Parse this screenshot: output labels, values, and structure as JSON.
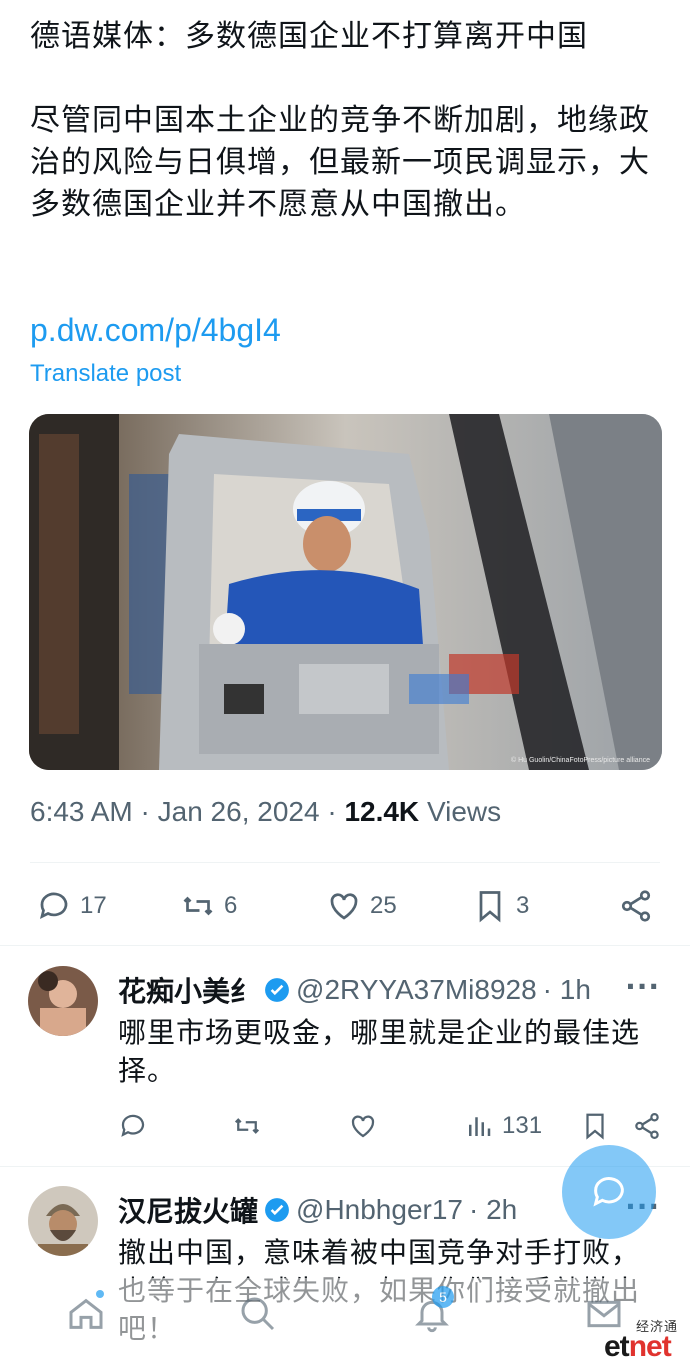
{
  "post": {
    "headline": "德语媒体：多数德国企业不打算离开中国",
    "body": "尽管同中国本土企业的竞争不断加剧，地缘政治的风险与日俱增，但最新一项民调显示，大多数德国企业并不愿意从中国撤出。",
    "link": "p.dw.com/p/4bgI4",
    "translate": "Translate post",
    "image_credit": "© Hu Guolin/ChinaFotoPress/picture alliance",
    "time": "6:43 AM",
    "date": "Jan 26, 2024",
    "views_count": "12.4K",
    "views_label": "Views",
    "stats": {
      "replies": "17",
      "reposts": "6",
      "likes": "25",
      "bookmarks": "3"
    }
  },
  "replies": [
    {
      "name": "花痴小美纟",
      "handle": "@2RYYA37Mi8928",
      "time": "· 1h",
      "more": "···",
      "text": "哪里市场更吸金，哪里就是企业的最佳选择。",
      "views": "131"
    },
    {
      "name": "汉尼拔火罐",
      "handle": "@Hnbhger17",
      "time": "· 2h",
      "more": "···",
      "text": "撤出中国，意味着被中国竞争对手打败，也等于在全球失败，如果你们接受就撤出吧！",
      "views": ""
    }
  ],
  "nav": {
    "notifications_badge": "5"
  },
  "watermark": {
    "cn": "经济通",
    "en_a": "et",
    "en_b": "net"
  },
  "colors": {
    "accent": "#1d9bf0",
    "muted": "#536471",
    "text": "#0f1419",
    "watermark_red": "#e0332e"
  }
}
